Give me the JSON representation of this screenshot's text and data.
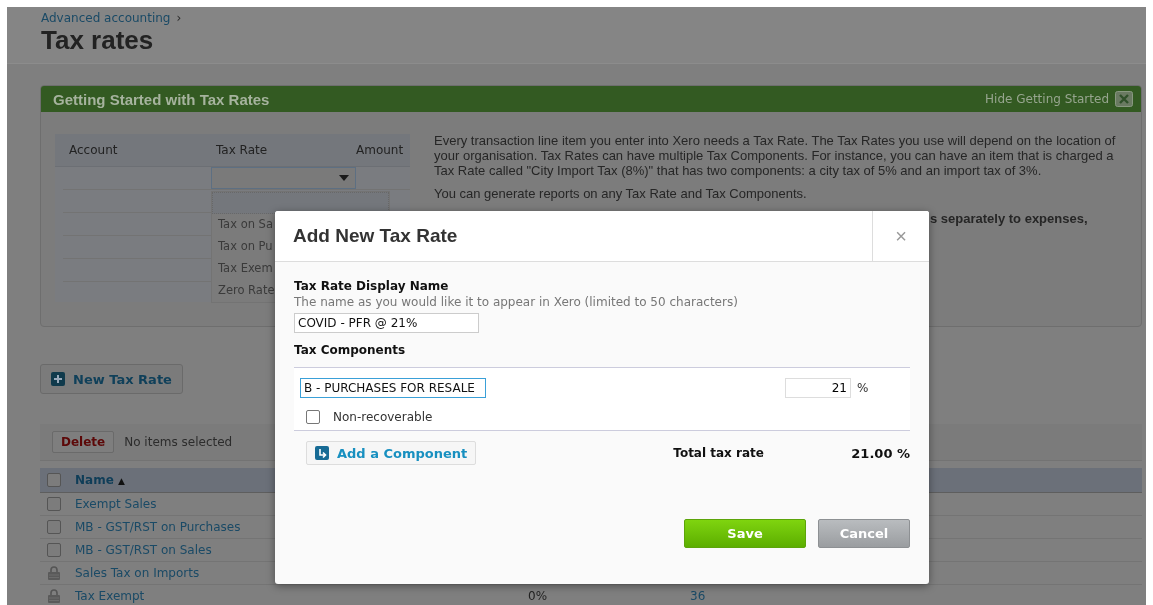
{
  "breadcrumb": {
    "link": "Advanced accounting",
    "separator": "›"
  },
  "page_title": "Tax rates",
  "getting_started": {
    "title": "Getting Started with Tax Rates",
    "hide_label": "Hide Getting Started",
    "example_table": {
      "columns": [
        "Account",
        "Tax Rate",
        "Amount"
      ],
      "options": [
        "Tax on Sa",
        "Tax on Pu",
        "Tax Exem",
        "Zero Rate"
      ]
    },
    "paragraphs": [
      "Every transaction line item you enter into Xero needs a Tax Rate. The Tax Rates you use will depend on the location of your organisation. Tax Rates can have multiple Tax Components. For instance, you can have an item that is charged a Tax Rate called \"City Import Tax (8%)\" that has two components: a city tax of 5% and an import tax of 3%.",
      "You can generate reports on any Tax Rate and Tax Components."
    ],
    "bold_fragment": "s separately to expenses,"
  },
  "new_button": "New Tax Rate",
  "list": {
    "delete_button": "Delete",
    "selection_status": "No items selected",
    "header_checked": false,
    "name_column": {
      "label": "Name",
      "sort_arrow": "▲"
    },
    "rows": [
      {
        "name": "Exempt Sales",
        "locked": false,
        "checked": false
      },
      {
        "name": "MB - GST/RST on Purchases",
        "locked": false,
        "checked": false
      },
      {
        "name": "MB - GST/RST on Sales",
        "locked": false,
        "checked": false
      },
      {
        "name": "Sales Tax on Imports",
        "locked": true
      },
      {
        "name": "Tax Exempt",
        "locked": true,
        "rate": "0%",
        "count": "36"
      }
    ]
  },
  "modal": {
    "title": "Add New Tax Rate",
    "close": "×",
    "display_name": {
      "label": "Tax Rate Display Name",
      "hint": "The name as you would like it to appear in Xero (limited to 50 characters)",
      "value": "COVID - PFR @ 21%"
    },
    "components_label": "Tax Components",
    "components": [
      {
        "name": "B - PURCHASES FOR RESALE",
        "focused": true,
        "percent": "21",
        "unit": "%",
        "non_recoverable": {
          "label": "Non-recoverable",
          "checked": false
        }
      }
    ],
    "add_button": "Add a Component",
    "total_label": "Total tax rate",
    "total_value": "21.00 %",
    "buttons": [
      {
        "label": "Save",
        "kind": "primary"
      },
      {
        "label": "Cancel",
        "kind": "secondary"
      }
    ]
  }
}
